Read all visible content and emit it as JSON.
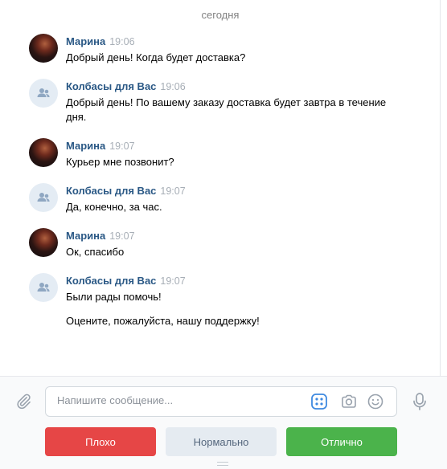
{
  "chat": {
    "date_separator": "сегодня",
    "messages": [
      {
        "author": "Марина",
        "time": "19:06",
        "avatar": "user-photo",
        "lines": [
          "Добрый день! Когда будет доставка?"
        ]
      },
      {
        "author": "Колбасы для Вас",
        "time": "19:06",
        "avatar": "group-icon",
        "lines": [
          "Добрый день! По вашему заказу доставка будет завтра в течение дня."
        ]
      },
      {
        "author": "Марина",
        "time": "19:07",
        "avatar": "user-photo",
        "lines": [
          "Курьер мне позвонит?"
        ]
      },
      {
        "author": "Колбасы для Вас",
        "time": "19:07",
        "avatar": "group-icon",
        "lines": [
          "Да, конечно, за час."
        ]
      },
      {
        "author": "Марина",
        "time": "19:07",
        "avatar": "user-photo",
        "lines": [
          "Ок, спасибо"
        ]
      },
      {
        "author": "Колбасы для Вас",
        "time": "19:07",
        "avatar": "group-icon",
        "lines": [
          "Были рады помочь!",
          "Оцените, пожалуйста, нашу поддержку!"
        ]
      }
    ]
  },
  "composer": {
    "placeholder": "Напишите сообщение...",
    "value": "",
    "icons": [
      "paperclip-icon",
      "keyboard-bot-icon",
      "camera-icon",
      "smile-icon",
      "microphone-icon"
    ]
  },
  "rating": {
    "bad": "Плохо",
    "normal": "Нормально",
    "good": "Отлично"
  },
  "colors": {
    "author": "#2a5885",
    "bad": "#e64646",
    "normal_bg": "#e5ebf1",
    "good": "#4bb34b"
  }
}
